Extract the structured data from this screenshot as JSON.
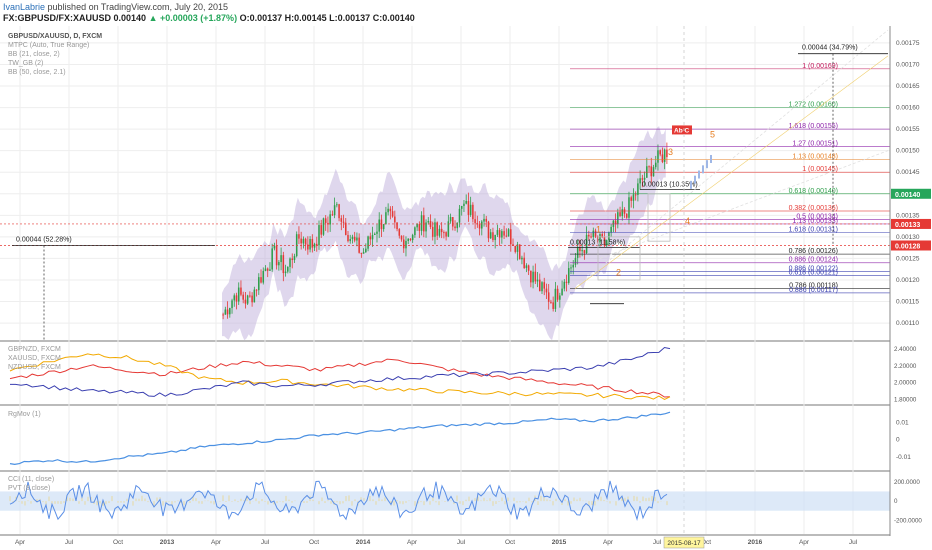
{
  "header": {
    "author": "IvanLabrie",
    "published": "published on TradingView.com, July 20, 2015",
    "symbol": "FX:GBPUSD/FX:XAUUSD",
    "last": "0.00140",
    "change": "▲ +0.00003 (+1.87%)",
    "ohlc": {
      "o": "0.00137",
      "h": "0.00145",
      "l": "0.00137",
      "c": "0.00140"
    }
  },
  "legend_main": [
    "GBPUSD/XAUUSD, D, FXCM",
    "MTPC (Auto, True Range)",
    "BB (21, close, 2)",
    "TW_GB (2)",
    "BB (50, close, 2.1)"
  ],
  "legend_cmp": [
    "GBPNZD, FXCM",
    "XAUUSD, FXCM",
    "NZDUSD, FXCM"
  ],
  "legend_rgmov": "RgMov (1)",
  "legend_cci": [
    "CCI (11, close)",
    "PVT (8,close)"
  ],
  "colors": {
    "candle_up": "#2e9e4a",
    "candle_down": "#e53935",
    "band": "#b7a7d6",
    "gbpnzd": "#e53935",
    "xauusd": "#f2a900",
    "nzdusd": "#3a3fb0",
    "rgmov": "#4a90e2",
    "cci": "#5b8fe6"
  },
  "chart_data": {
    "type": "line",
    "main_axis": {
      "ticks": [
        "0.00175",
        "0.00170",
        "0.00165",
        "0.00160",
        "0.00155",
        "0.00150",
        "0.00145",
        "0.00140",
        "0.00135",
        "0.00130",
        "0.00125",
        "0.00120",
        "0.00115",
        "0.00110"
      ],
      "ylim": [
        0.00107,
        0.00178
      ]
    },
    "price_badges": [
      {
        "value": "0.00140",
        "color": "#26a65b"
      },
      {
        "value": "0.00133",
        "color": "#e53935"
      },
      {
        "value": "0.00128",
        "color": "#e53935"
      }
    ],
    "x_labels": [
      "Apr",
      "Jul",
      "Oct",
      "2013",
      "Apr",
      "Jul",
      "Oct",
      "2014",
      "Apr",
      "Jul",
      "Oct",
      "2015",
      "Apr",
      "Jul",
      "Oct",
      "2016",
      "Apr",
      "Jul"
    ],
    "cursor_date": "2015-08-17",
    "price_series": [
      0.00112,
      0.00117,
      0.00115,
      0.00121,
      0.00126,
      0.00122,
      0.0013,
      0.00128,
      0.00133,
      0.00137,
      0.0013,
      0.00126,
      0.00132,
      0.00135,
      0.00129,
      0.00131,
      0.00134,
      0.0013,
      0.00133,
      0.00137,
      0.00135,
      0.00131,
      0.00132,
      0.00129,
      0.00123,
      0.00118,
      0.00115,
      0.00121,
      0.00126,
      0.0013,
      0.00128,
      0.00133,
      0.00137,
      0.00143,
      0.00147,
      0.0015
    ],
    "annotations": [
      {
        "text": "0.00044 (52.28%)"
      },
      {
        "text": "0.00044 (34.79%)"
      },
      {
        "text": "0.00013 (10.35%)"
      },
      {
        "text": "0.00013 (11.58%)"
      }
    ],
    "fib_levels": [
      {
        "text": "1 (0.00169)",
        "color": "#c2185b",
        "value": 0.00169
      },
      {
        "text": "1.272 (0.00160)",
        "color": "#2e9e4a",
        "value": 0.0016
      },
      {
        "text": "1.618 (0.00155)",
        "color": "#8e24aa",
        "value": 0.00155
      },
      {
        "text": "1.27 (0.00151)",
        "color": "#8e24aa",
        "value": 0.00151
      },
      {
        "text": "1.13 (0.00148)",
        "color": "#e67e22",
        "value": 0.00148
      },
      {
        "text": "1 (0.00145)",
        "color": "#e53935",
        "value": 0.00145
      },
      {
        "text": "0.618 (0.00140)",
        "color": "#2e9e4a",
        "value": 0.0014
      },
      {
        "text": "0.382 (0.00136)",
        "color": "#e53935",
        "value": 0.00136
      },
      {
        "text": "0.5 (0.00134)",
        "color": "#8e24aa",
        "value": 0.00134
      },
      {
        "text": "1.13 (0.00133)",
        "color": "#8e24aa",
        "value": 0.00133
      },
      {
        "text": "1.618 (0.00131)",
        "color": "#3a3fb0",
        "value": 0.00131
      },
      {
        "text": "0.786 (0.00126)",
        "color": "#222222",
        "value": 0.00126
      },
      {
        "text": "0.886 (0.00124)",
        "color": "#8e24aa",
        "value": 0.00124
      },
      {
        "text": "0.886 (0.00122)",
        "color": "#3a3fb0",
        "value": 0.00122
      },
      {
        "text": "0.618 (0.00121)",
        "color": "#3a3fb0",
        "value": 0.00121
      },
      {
        "text": "0.786 (0.00118)",
        "color": "#222222",
        "value": 0.00118
      },
      {
        "text": "0.886 (0.00117)",
        "color": "#3a3fb0",
        "value": 0.00117
      }
    ],
    "wave_labels": [
      "1",
      "2",
      "3",
      "4",
      "5"
    ],
    "abc_label": "Ab C",
    "cmp_axis": {
      "ticks": [
        "2.40000",
        "2.20000",
        "2.00000",
        "1.80000"
      ]
    },
    "cmp_series": {
      "GBPNZD": [
        2.05,
        2.12,
        2.2,
        2.15,
        2.1,
        2.18,
        2.25,
        2.2,
        2.15,
        2.22,
        2.28,
        2.18,
        2.1,
        2.05,
        2.0,
        1.95,
        1.9,
        1.84
      ],
      "XAUUSD": [
        2.15,
        2.25,
        2.35,
        2.3,
        2.2,
        2.05,
        2.0,
        2.02,
        1.98,
        1.95,
        1.92,
        1.9,
        1.88,
        1.87,
        1.86,
        1.85,
        1.83,
        1.81
      ],
      "NZDUSD": [
        2.0,
        1.95,
        1.9,
        1.88,
        1.85,
        1.92,
        2.0,
        1.96,
        1.98,
        2.02,
        2.05,
        2.08,
        2.1,
        2.12,
        2.15,
        2.18,
        2.28,
        2.42
      ]
    },
    "rgmov_axis": {
      "ticks": [
        "0.01",
        "0",
        "-0.01"
      ]
    },
    "rgmov_series": [
      -0.014,
      -0.012,
      -0.013,
      -0.01,
      -0.008,
      -0.004,
      -0.002,
      0.0,
      0.003,
      0.004,
      0.006,
      0.008,
      0.009,
      0.01,
      0.012,
      0.011,
      0.013,
      0.016
    ],
    "cci_axis": {
      "ticks": [
        "200.0000",
        "0",
        "-200.0000"
      ]
    }
  }
}
